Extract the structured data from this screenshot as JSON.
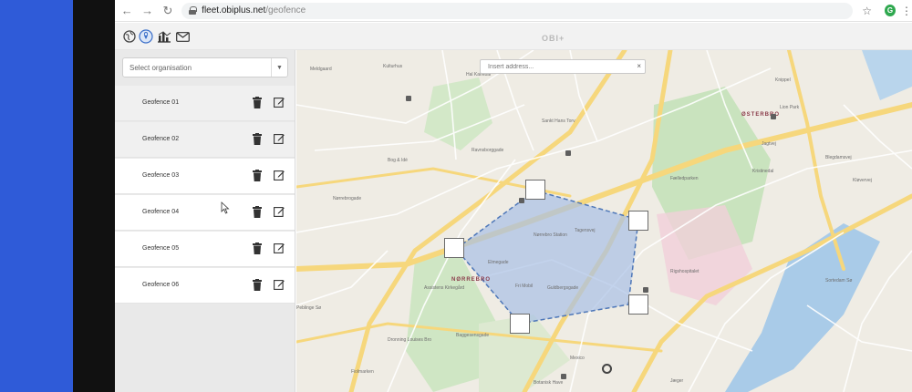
{
  "browser": {
    "url_host": "fleet.obiplus.net",
    "url_path": "/geofence",
    "profile_initial": "G"
  },
  "app": {
    "brand": "OBI+",
    "nav_icons": [
      "globe-icon",
      "map-pin-icon",
      "chart-icon",
      "mail-icon"
    ]
  },
  "sidebar": {
    "select_placeholder": "Select organisation",
    "geofences": [
      {
        "name": "Geofence 01"
      },
      {
        "name": "Geofence 02"
      },
      {
        "name": "Geofence 03"
      },
      {
        "name": "Geofence 04"
      },
      {
        "name": "Geofence 05"
      },
      {
        "name": "Geofence 06"
      }
    ]
  },
  "map": {
    "address_placeholder": "Insert address...",
    "clear_label": "×",
    "district_labels": [
      "ØSTERBRO",
      "NØRREBRO"
    ],
    "place_labels": [
      "Meldgaard",
      "Kulturhus",
      "Bog & Idé",
      "Hal Kaffebar",
      "Sankt Hans Torv",
      "Ravnsborggade",
      "Nørrebrogade",
      "Assistens Kirkegård",
      "Fælledparken",
      "Jagtvej",
      "Blegdamsvej",
      "Sortedam Sø",
      "Kristinedal",
      "Nørrebro Station",
      "Kløvervej",
      "Tagensvej",
      "Rigshospitalet",
      "Fiolmarken",
      "Peblinge Sø",
      "Dronning Louises Bro",
      "Elmegade",
      "Fri Mobil",
      "Baggesensgade",
      "Mexico",
      "Guldbergsgade",
      "Lion Park",
      "Knippel",
      "Jæger",
      "Botanisk Have"
    ],
    "colors": {
      "polygon_fill": "#a9c0e6",
      "polygon_stroke": "#4e77b8",
      "park": "#c7e2bd",
      "water": "#a9cbe8",
      "road_major": "#f6d77c"
    }
  }
}
